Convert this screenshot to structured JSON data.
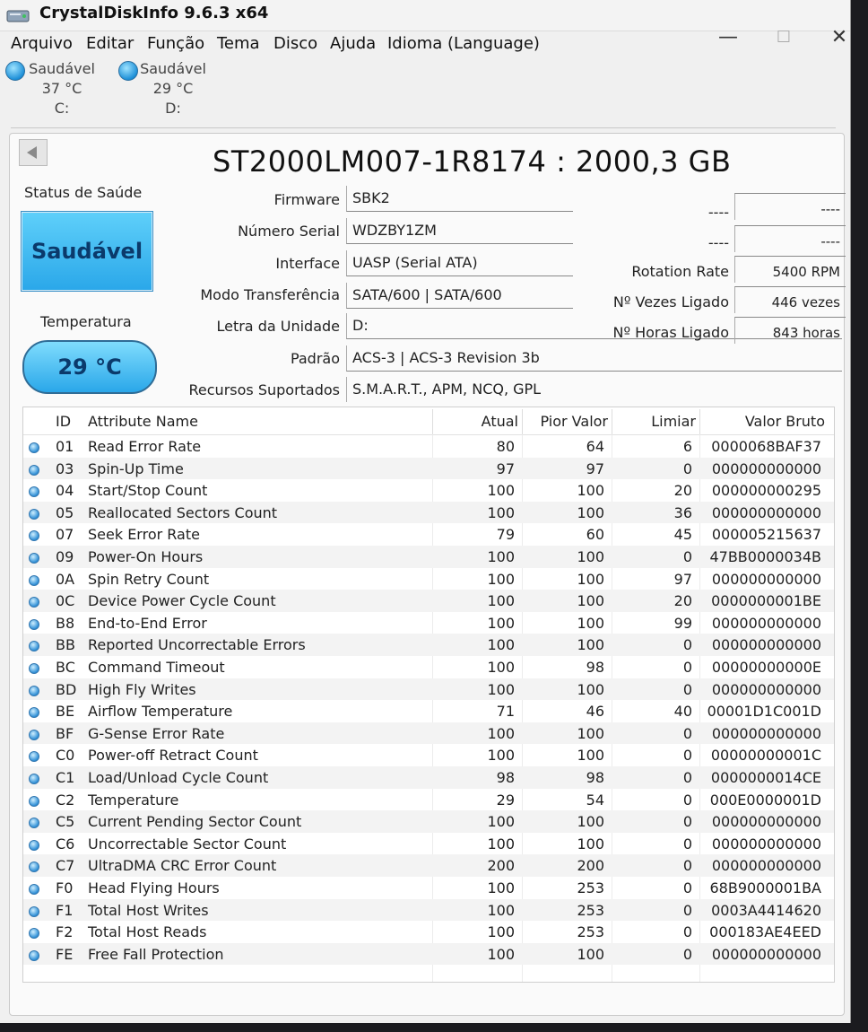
{
  "window": {
    "title": "CrystalDiskInfo 9.6.3 x64",
    "minimize_glyph": "—",
    "maximize_glyph": "☐",
    "close_glyph": "✕"
  },
  "menu": [
    "Arquivo",
    "Editar",
    "Função",
    "Tema",
    "Disco",
    "Ajuda",
    "Idioma (Language)"
  ],
  "drives": [
    {
      "status": "Saudável",
      "temp": "37 °C",
      "letter": "C:"
    },
    {
      "status": "Saudável",
      "temp": "29 °C",
      "letter": "D:"
    }
  ],
  "disk": {
    "model": "ST2000LM007-1R8174 : 2000,3 GB",
    "health_label": "Status de Saúde",
    "health_status": "Saudável",
    "temp_label": "Temperatura",
    "temp_value": "29 °C",
    "firmware_label": "Firmware",
    "firmware": "SBK2",
    "serial_label": "Número Serial",
    "serial": "WDZBY1ZM",
    "interface_label": "Interface",
    "interface": "UASP (Serial ATA)",
    "transfer_label": "Modo Transferência",
    "transfer": "SATA/600 | SATA/600",
    "letter_label": "Letra da Unidade",
    "letter": "D:",
    "standard_label": "Padrão",
    "standard": "ACS-3 | ACS-3 Revision 3b",
    "features_label": "Recursos Suportados",
    "features": "S.M.A.R.T., APM, NCQ, GPL",
    "dash1_label": "----",
    "dash1_value": "----",
    "dash2_label": "----",
    "dash2_value": "----",
    "rotation_label": "Rotation Rate",
    "rotation": "5400 RPM",
    "power_count_label": "Nº Vezes Ligado",
    "power_count": "446 vezes",
    "power_hours_label": "Nº Horas Ligado",
    "power_hours": "843 horas"
  },
  "smart": {
    "headers": {
      "id": "ID",
      "name": "Attribute Name",
      "current": "Atual",
      "worst": "Pior Valor",
      "threshold": "Limiar",
      "raw": "Valor Bruto"
    },
    "rows": [
      {
        "id": "01",
        "name": "Read Error Rate",
        "current": "80",
        "worst": "64",
        "threshold": "6",
        "raw": "0000068BAF37"
      },
      {
        "id": "03",
        "name": "Spin-Up Time",
        "current": "97",
        "worst": "97",
        "threshold": "0",
        "raw": "000000000000"
      },
      {
        "id": "04",
        "name": "Start/Stop Count",
        "current": "100",
        "worst": "100",
        "threshold": "20",
        "raw": "000000000295"
      },
      {
        "id": "05",
        "name": "Reallocated Sectors Count",
        "current": "100",
        "worst": "100",
        "threshold": "36",
        "raw": "000000000000"
      },
      {
        "id": "07",
        "name": "Seek Error Rate",
        "current": "79",
        "worst": "60",
        "threshold": "45",
        "raw": "000005215637"
      },
      {
        "id": "09",
        "name": "Power-On Hours",
        "current": "100",
        "worst": "100",
        "threshold": "0",
        "raw": "47BB0000034B"
      },
      {
        "id": "0A",
        "name": "Spin Retry Count",
        "current": "100",
        "worst": "100",
        "threshold": "97",
        "raw": "000000000000"
      },
      {
        "id": "0C",
        "name": "Device Power Cycle Count",
        "current": "100",
        "worst": "100",
        "threshold": "20",
        "raw": "0000000001BE"
      },
      {
        "id": "B8",
        "name": "End-to-End Error",
        "current": "100",
        "worst": "100",
        "threshold": "99",
        "raw": "000000000000"
      },
      {
        "id": "BB",
        "name": "Reported Uncorrectable Errors",
        "current": "100",
        "worst": "100",
        "threshold": "0",
        "raw": "000000000000"
      },
      {
        "id": "BC",
        "name": "Command Timeout",
        "current": "100",
        "worst": "98",
        "threshold": "0",
        "raw": "00000000000E"
      },
      {
        "id": "BD",
        "name": "High Fly Writes",
        "current": "100",
        "worst": "100",
        "threshold": "0",
        "raw": "000000000000"
      },
      {
        "id": "BE",
        "name": "Airflow Temperature",
        "current": "71",
        "worst": "46",
        "threshold": "40",
        "raw": "00001D1C001D"
      },
      {
        "id": "BF",
        "name": "G-Sense Error Rate",
        "current": "100",
        "worst": "100",
        "threshold": "0",
        "raw": "000000000000"
      },
      {
        "id": "C0",
        "name": "Power-off Retract Count",
        "current": "100",
        "worst": "100",
        "threshold": "0",
        "raw": "00000000001C"
      },
      {
        "id": "C1",
        "name": "Load/Unload Cycle Count",
        "current": "98",
        "worst": "98",
        "threshold": "0",
        "raw": "0000000014CE"
      },
      {
        "id": "C2",
        "name": "Temperature",
        "current": "29",
        "worst": "54",
        "threshold": "0",
        "raw": "000E0000001D"
      },
      {
        "id": "C5",
        "name": "Current Pending Sector Count",
        "current": "100",
        "worst": "100",
        "threshold": "0",
        "raw": "000000000000"
      },
      {
        "id": "C6",
        "name": "Uncorrectable Sector Count",
        "current": "100",
        "worst": "100",
        "threshold": "0",
        "raw": "000000000000"
      },
      {
        "id": "C7",
        "name": "UltraDMA CRC Error Count",
        "current": "200",
        "worst": "200",
        "threshold": "0",
        "raw": "000000000000"
      },
      {
        "id": "F0",
        "name": "Head Flying Hours",
        "current": "100",
        "worst": "253",
        "threshold": "0",
        "raw": "68B9000001BA"
      },
      {
        "id": "F1",
        "name": "Total Host Writes",
        "current": "100",
        "worst": "253",
        "threshold": "0",
        "raw": "0003A4414620"
      },
      {
        "id": "F2",
        "name": "Total Host Reads",
        "current": "100",
        "worst": "253",
        "threshold": "0",
        "raw": "000183AE4EED"
      },
      {
        "id": "FE",
        "name": "Free Fall Protection",
        "current": "100",
        "worst": "100",
        "threshold": "0",
        "raw": "000000000000"
      }
    ]
  }
}
